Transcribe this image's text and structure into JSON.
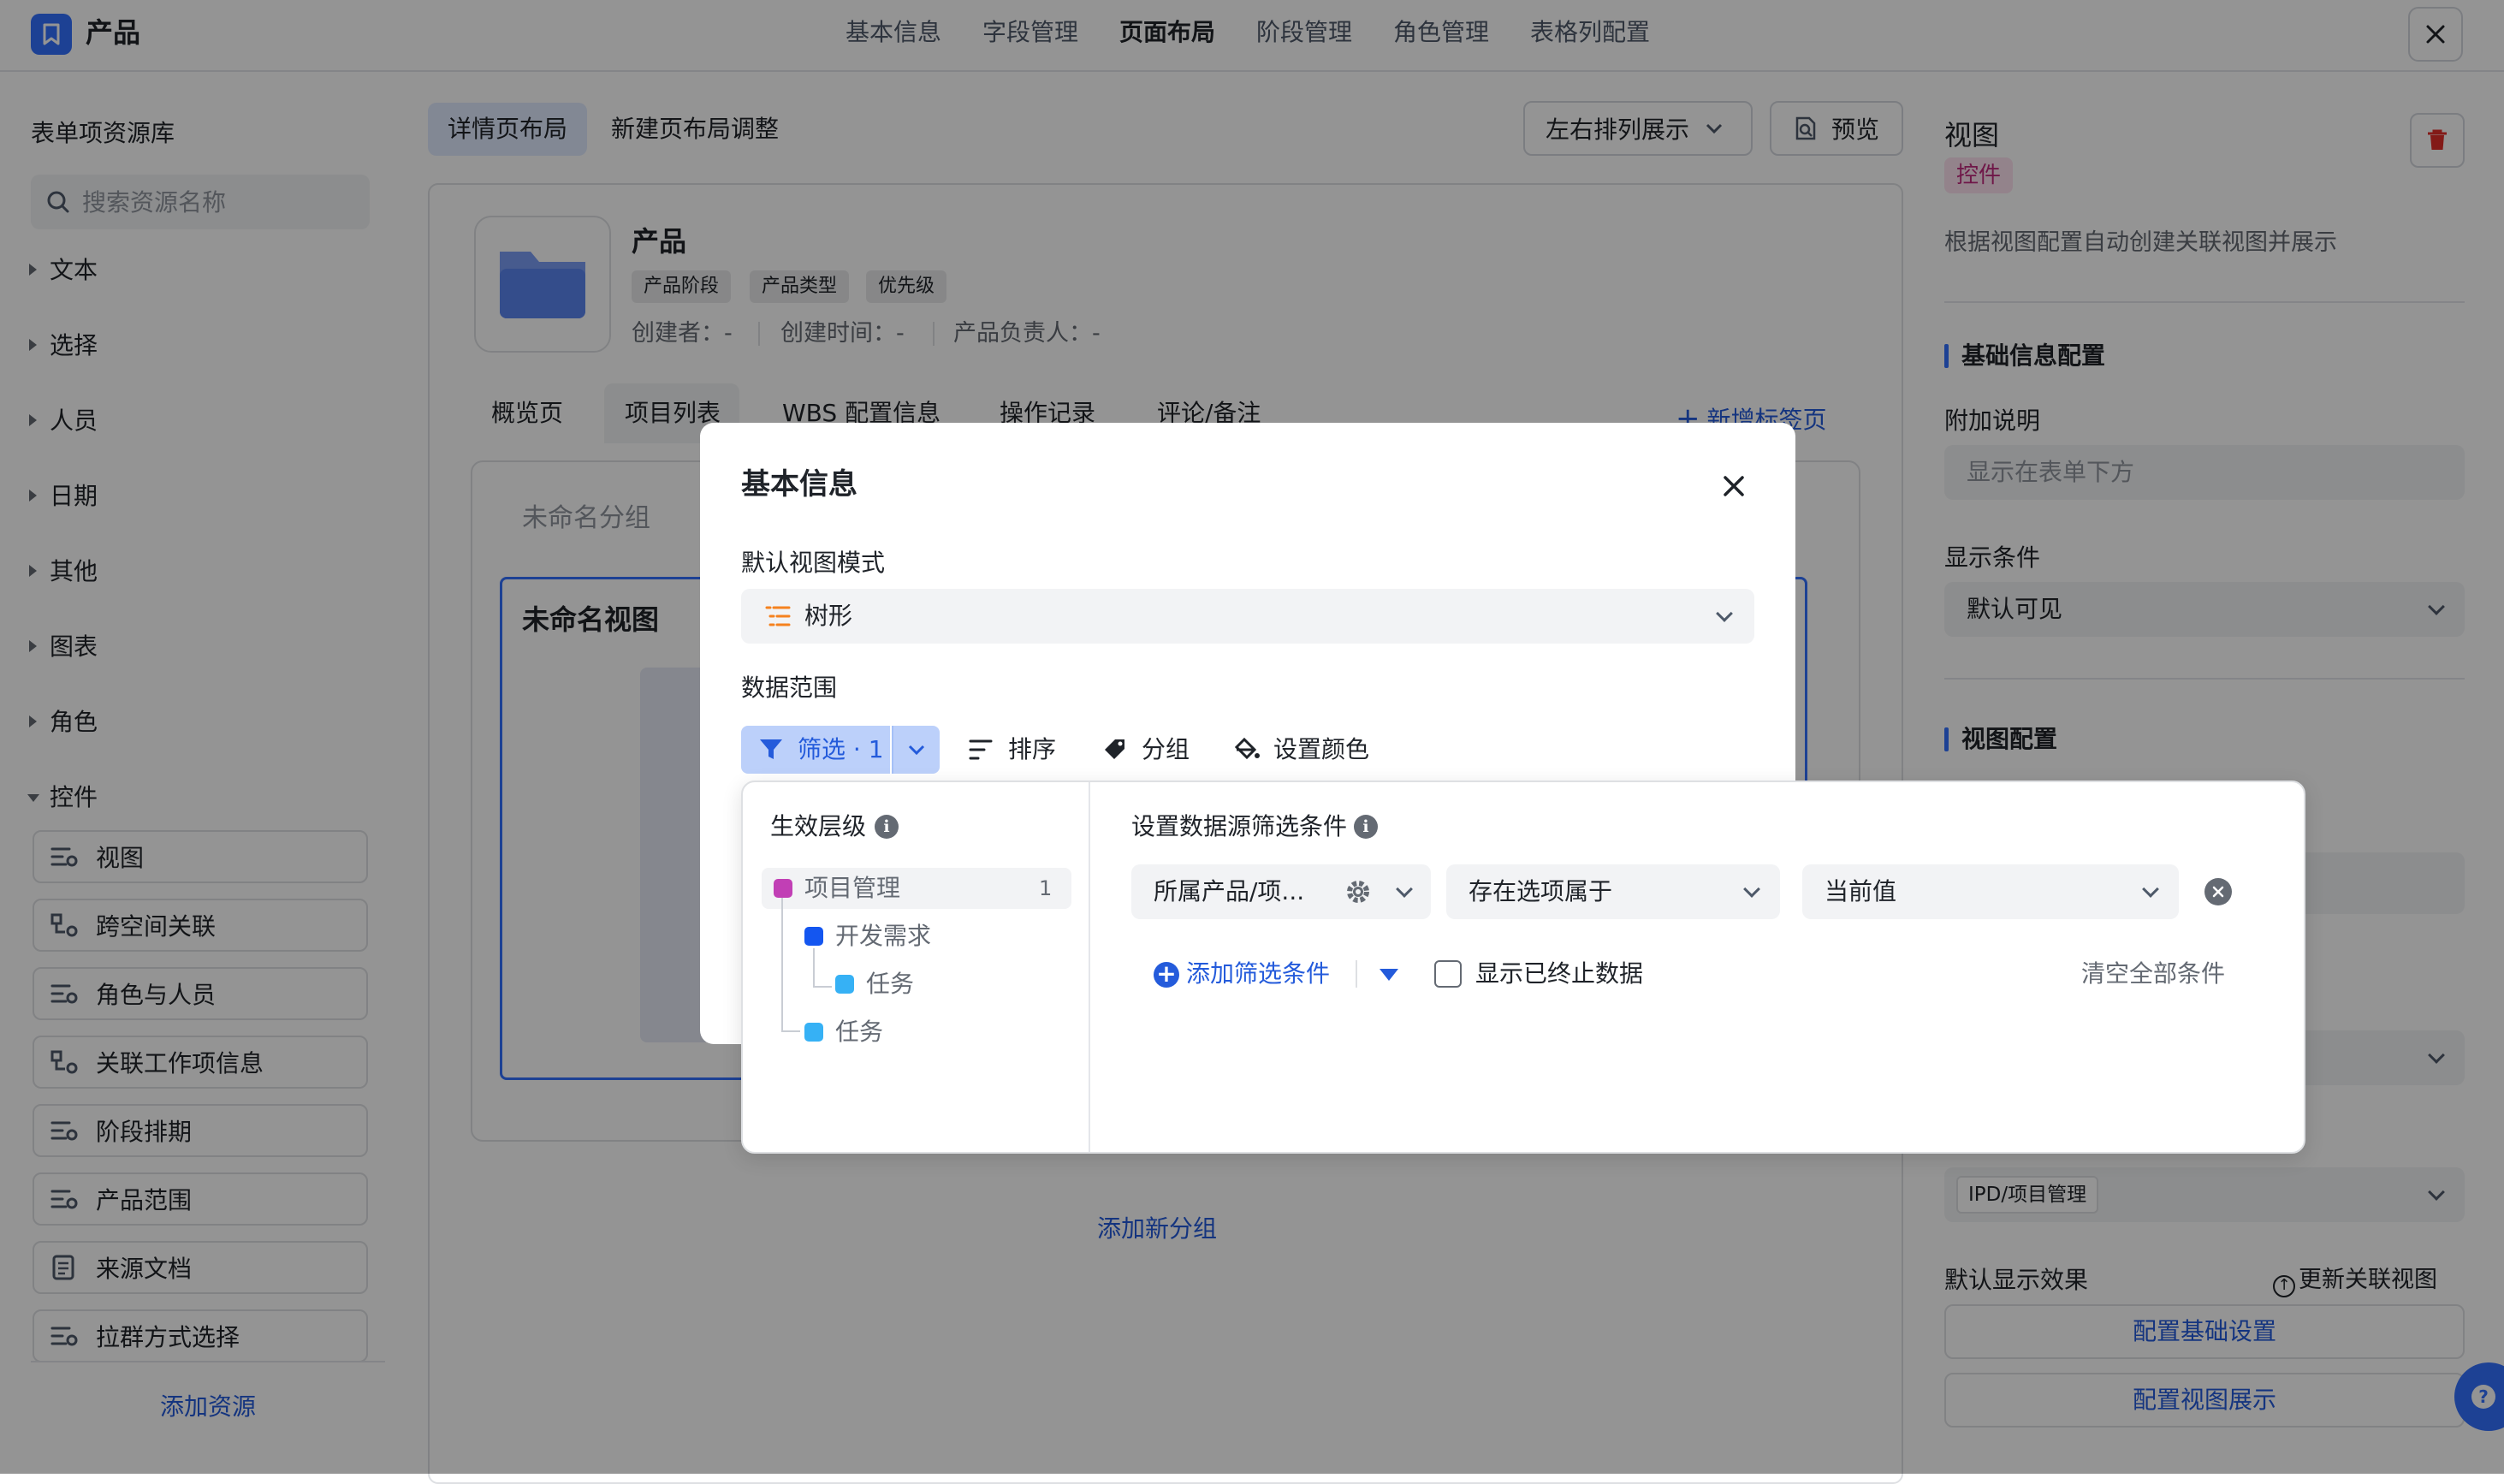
{
  "app": {
    "title": "产品"
  },
  "top_tabs": [
    {
      "label": "基本信息"
    },
    {
      "label": "字段管理"
    },
    {
      "label": "页面布局"
    },
    {
      "label": "阶段管理"
    },
    {
      "label": "角色管理"
    },
    {
      "label": "表格列配置"
    }
  ],
  "sidebar": {
    "title": "表单项资源库",
    "search_placeholder": "搜索资源名称",
    "categories": [
      "文本",
      "选择",
      "人员",
      "日期",
      "其他",
      "图表",
      "角色",
      "控件"
    ],
    "controls": [
      "视图",
      "跨空间关联",
      "角色与人员",
      "关联工作项信息",
      "阶段排期",
      "产品范围",
      "来源文档",
      "拉群方式选择"
    ],
    "add_resource": "添加资源"
  },
  "layout_tabs": {
    "detail": "详情页布局",
    "new": "新建页布局调整"
  },
  "toolbar": {
    "arrange": "左右排列展示",
    "preview": "预览"
  },
  "product": {
    "name": "产品",
    "tags": [
      "产品阶段",
      "产品类型",
      "优先级"
    ],
    "meta": [
      "创建者：-",
      "创建时间：-",
      "产品负责人：-"
    ]
  },
  "detail_tabs": [
    "概览页",
    "项目列表",
    "WBS 配置信息",
    "操作记录",
    "评论/备注"
  ],
  "new_tab": "新增标签页",
  "group": {
    "name": "未命名分组",
    "view_title": "未命名视图",
    "add_group": "添加新分组"
  },
  "right_panel": {
    "title": "视图",
    "badge": "控件",
    "description": "根据视图配置自动创建关联视图并展示",
    "basic_section": "基础信息配置",
    "note_label": "附加说明",
    "note_placeholder": "显示在表单下方",
    "cond_label": "显示条件",
    "cond_value": "默认可见",
    "view_section": "视图配置",
    "space_tag": "IPD/项目管理",
    "default_effect": "默认显示效果",
    "refresh": "更新关联视图",
    "btn_basic": "配置基础设置",
    "btn_view": "配置视图展示"
  },
  "modal": {
    "title": "基本信息",
    "mode_label": "默认视图模式",
    "mode_value": "树形",
    "range_label": "数据范围",
    "filter_btn": "筛选 · 1",
    "sort_btn": "排序",
    "group_btn": "分组",
    "color_btn": "设置颜色"
  },
  "filter": {
    "level_title": "生效层级",
    "tree": [
      {
        "label": "项目管理",
        "color": "#c13fb5",
        "count": "1"
      },
      {
        "label": "开发需求",
        "color": "#1456f0"
      },
      {
        "label": "任务",
        "color": "#36b1f5"
      },
      {
        "label": "任务",
        "color": "#36b1f5"
      }
    ],
    "cond_title": "设置数据源筛选条件",
    "field": "所属产品/项...",
    "operator": "存在选项属于",
    "value": "当前值",
    "add_condition": "添加筛选条件",
    "show_ended": "显示已终止数据",
    "clear_all": "清空全部条件"
  }
}
